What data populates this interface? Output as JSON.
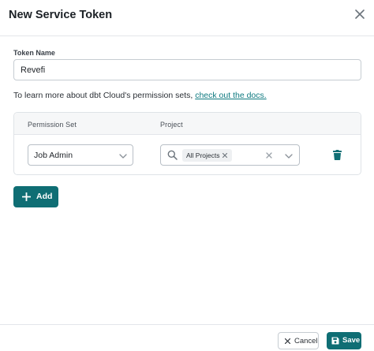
{
  "header": {
    "title": "New Service Token"
  },
  "form": {
    "token_name_label": "Token Name",
    "token_name_value": "Revefi",
    "docs_prefix": "To learn more about dbt Cloud's permission sets, ",
    "docs_link": "check out the docs."
  },
  "permissions": {
    "column_permission_set": "Permission Set",
    "column_project": "Project",
    "rows": [
      {
        "permission_set": "Job Admin",
        "projects": [
          "All Projects"
        ]
      }
    ]
  },
  "actions": {
    "add_label": "Add"
  },
  "footer": {
    "cancel_label": "Cancel",
    "save_label": "Save"
  },
  "colors": {
    "accent": "#0f6e74",
    "link": "#0f7a80"
  }
}
